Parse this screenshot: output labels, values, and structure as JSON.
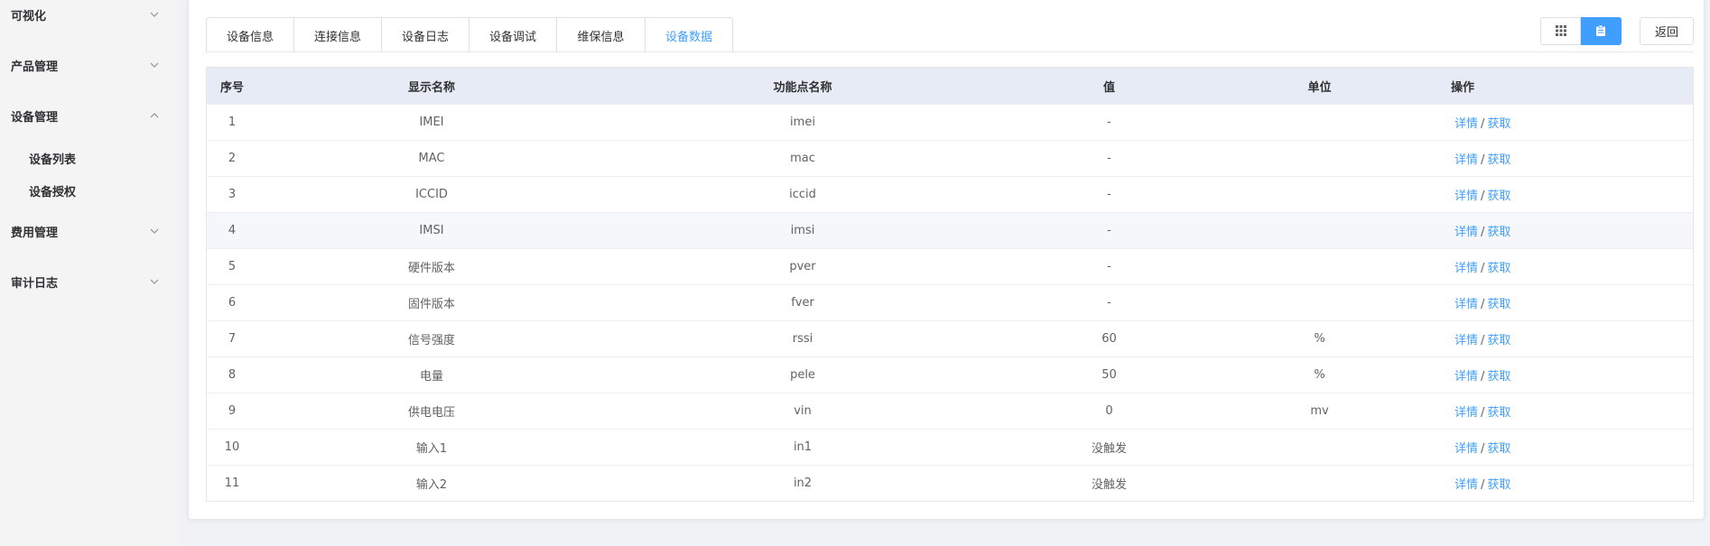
{
  "sidebar": {
    "groups": [
      {
        "label": "可视化",
        "expanded": false
      },
      {
        "label": "产品管理",
        "expanded": false
      },
      {
        "label": "设备管理",
        "expanded": true
      },
      {
        "label": "费用管理",
        "expanded": false
      },
      {
        "label": "审计日志",
        "expanded": false
      }
    ],
    "sub_items": [
      "设备列表",
      "设备授权"
    ]
  },
  "tabs": [
    {
      "label": "设备信息",
      "active": false
    },
    {
      "label": "连接信息",
      "active": false
    },
    {
      "label": "设备日志",
      "active": false
    },
    {
      "label": "设备调试",
      "active": false
    },
    {
      "label": "维保信息",
      "active": false
    },
    {
      "label": "设备数据",
      "active": true
    }
  ],
  "toolbar": {
    "grid_view_icon": "grid-icon",
    "card_view_icon": "clipboard-icon",
    "back_label": "返回"
  },
  "table": {
    "headers": {
      "index": "序号",
      "display_name": "显示名称",
      "function_name": "功能点名称",
      "value": "值",
      "unit": "单位",
      "actions": "操作"
    },
    "detail_label": "详情",
    "action_sep": "/",
    "fetch_label": "获取",
    "rows": [
      {
        "index": "1",
        "display_name": "IMEI",
        "function_name": "imei",
        "value": "-",
        "unit": ""
      },
      {
        "index": "2",
        "display_name": "MAC",
        "function_name": "mac",
        "value": "-",
        "unit": ""
      },
      {
        "index": "3",
        "display_name": "ICCID",
        "function_name": "iccid",
        "value": "-",
        "unit": ""
      },
      {
        "index": "4",
        "display_name": "IMSI",
        "function_name": "imsi",
        "value": "-",
        "unit": ""
      },
      {
        "index": "5",
        "display_name": "硬件版本",
        "function_name": "pver",
        "value": "-",
        "unit": ""
      },
      {
        "index": "6",
        "display_name": "固件版本",
        "function_name": "fver",
        "value": "-",
        "unit": ""
      },
      {
        "index": "7",
        "display_name": "信号强度",
        "function_name": "rssi",
        "value": "60",
        "unit": "%"
      },
      {
        "index": "8",
        "display_name": "电量",
        "function_name": "pele",
        "value": "50",
        "unit": "%"
      },
      {
        "index": "9",
        "display_name": "供电电压",
        "function_name": "vin",
        "value": "0",
        "unit": "mv"
      },
      {
        "index": "10",
        "display_name": "输入1",
        "function_name": "in1",
        "value": "没触发",
        "unit": ""
      },
      {
        "index": "11",
        "display_name": "输入2",
        "function_name": "in2",
        "value": "没触发",
        "unit": ""
      }
    ]
  },
  "colors": {
    "accent": "#409eff",
    "header_bg": "#e6ebf5",
    "sidebar_bg": "#f4f4f5"
  }
}
